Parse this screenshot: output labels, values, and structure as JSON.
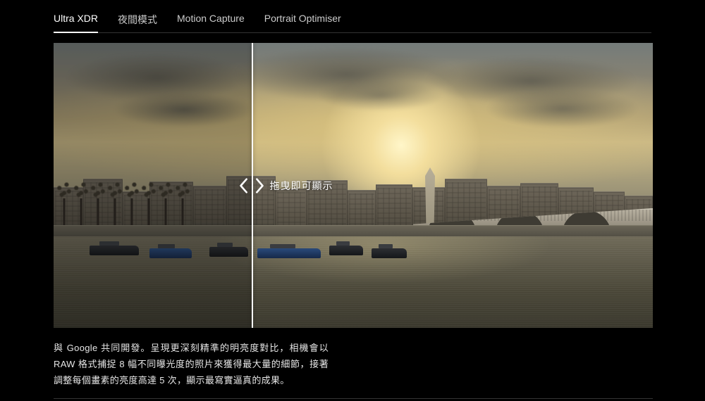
{
  "tabs": [
    {
      "label": "Ultra XDR",
      "active": true
    },
    {
      "label": "夜間模式",
      "active": false
    },
    {
      "label": "Motion Capture",
      "active": false
    },
    {
      "label": "Portrait Optimiser",
      "active": false
    }
  ],
  "comparison": {
    "drag_hint": "拖曳即可顯示",
    "divider_position_percent": 33
  },
  "description": "與 Google 共同開發。呈現更深刻精準的明亮度對比，相機會以 RAW 格式捕捉 8 幅不同曝光度的照片來獲得最大量的細節，接著調整每個畫素的亮度高達 5 次，顯示最寫實逼真的成果。"
}
